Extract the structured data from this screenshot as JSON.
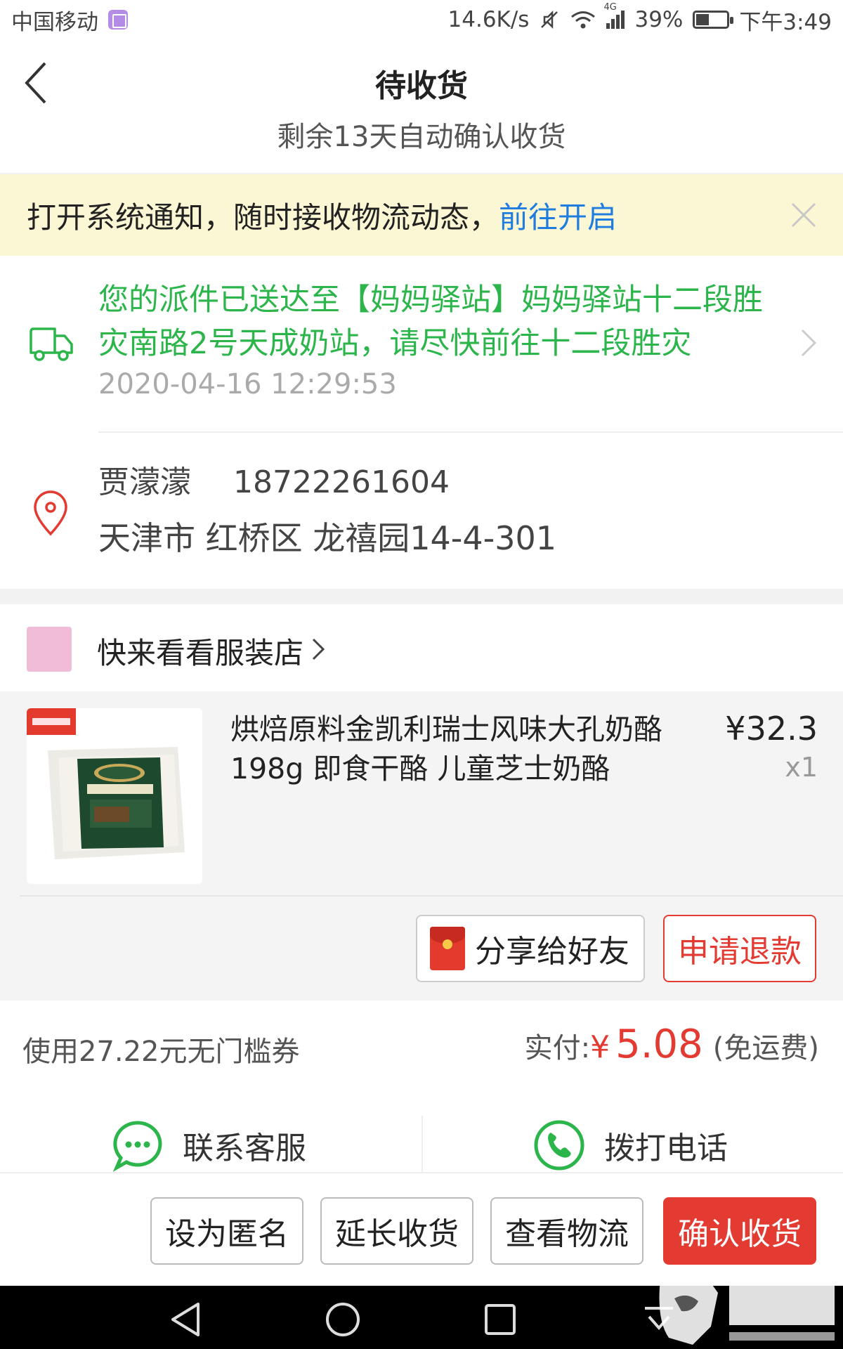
{
  "status_bar": {
    "carrier": "中国移动",
    "speed": "14.6K/s",
    "network": "4G",
    "battery": "39%",
    "battery_level": 0.39,
    "time": "下午3:49"
  },
  "header": {
    "title": "待收货",
    "subtitle": "剩余13天自动确认收货"
  },
  "notice": {
    "text": "打开系统通知，随时接收物流动态，",
    "link": "前往开启"
  },
  "logistics": {
    "message": "您的派件已送达至【妈妈驿站】妈妈驿站十二段胜灾南路2号天成奶站，请尽快前往十二段胜灾",
    "time": "2020-04-16 12:29:53"
  },
  "address": {
    "name": "贾濛濛",
    "phone": "18722261604",
    "detail": "天津市 红桥区 龙禧园14-4-301"
  },
  "shop": {
    "name": "快来看看服装店"
  },
  "product": {
    "name": "烘焙原料金凯利瑞士风味大孔奶酪198g 即食干酪 儿童芝士奶酪",
    "price": "¥32.3",
    "qty": "x1"
  },
  "item_actions": {
    "share": "分享给好友",
    "refund": "申请退款"
  },
  "summary": {
    "coupon": "使用27.22元无门槛券",
    "pay_label": "实付:",
    "currency": "¥",
    "amount": "5.08",
    "shipping": "(免运费)"
  },
  "service": {
    "contact": "联系客服",
    "call": "拨打电话"
  },
  "actions": {
    "anonymous": "设为匿名",
    "extend": "延长收货",
    "track": "查看物流",
    "confirm": "确认收货"
  },
  "colors": {
    "accent_red": "#e33a32",
    "logistics_green": "#2bb54b",
    "link_blue": "#1f7de0",
    "notice_bg": "#fbf6d3"
  }
}
